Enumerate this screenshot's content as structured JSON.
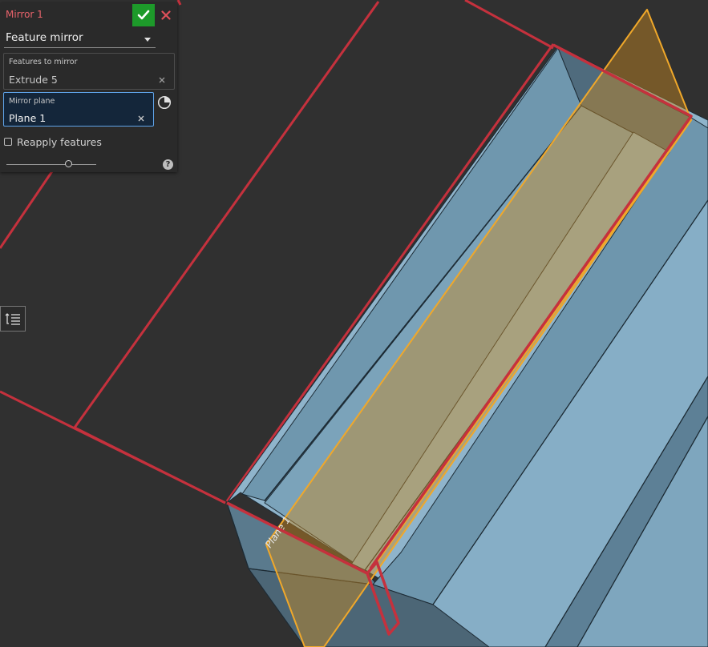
{
  "dialog": {
    "title": "Mirror 1",
    "type_value": "Feature mirror",
    "features_label": "Features to mirror",
    "features_value": "Extrude 5",
    "plane_label": "Mirror plane",
    "plane_value": "Plane 1",
    "reapply_label": "Reapply features",
    "reapply_checked": false,
    "slider_level": 0.69,
    "help_symbol": "?"
  },
  "viewport": {
    "plane_label": "Plane 1"
  },
  "icons": {
    "confirm": "check-icon",
    "cancel": "close-icon",
    "gauge": "pie-gauge-icon",
    "list": "feature-list-icon",
    "help": "help-icon"
  },
  "colors": {
    "background": "#303030",
    "panel": "#2a2a2a",
    "title": "#e8636b",
    "confirm": "#1d9a2a",
    "cancel": "#e0505a",
    "selected_field_border": "#5fa3e8",
    "part_face": "#7aa4bd",
    "highlight_edge": "#c5313d",
    "plane_edge": "#f0a82a"
  }
}
